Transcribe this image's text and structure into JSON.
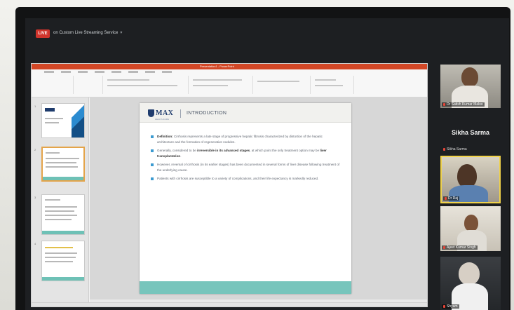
{
  "meeting": {
    "live_label": "LIVE",
    "title": "on Custom Live Streaming Service",
    "title_chevron": "▾"
  },
  "powerpoint": {
    "window_title": "Presentation1 - PowerPoint",
    "slide_numbers": [
      "1",
      "2",
      "3",
      "4"
    ],
    "slide": {
      "logo_text": "MAX",
      "logo_subtext": "HEALTHCARE",
      "title": "INTRODUCTION",
      "bullets": [
        {
          "bold": "Definition:",
          "text": " Cirrhosis represents a late stage of progressive hepatic fibrosis characterized by distortion of the hepatic architecture and the formation of regenerative nodules."
        },
        {
          "pre": "Generally, considered to be ",
          "bold": "irreversible in its advanced stages",
          "text": ", at which point the only treatment option may be ",
          "bold2": "liver transplantation",
          "post": "."
        },
        {
          "text": "However, reversal of cirrhosis (in its earlier stages) has been documented in several forms of liver disease following treatment of the underlying cause."
        },
        {
          "text": "Patients with cirrhosis are susceptible to a variety of complications, and their life expectancy is markedly reduced."
        }
      ]
    }
  },
  "participants": {
    "tiles": [
      {
        "name": "Dr Satish Kumar Maloo",
        "active": false
      },
      {
        "name": "Dr Raj",
        "active": true
      },
      {
        "name": "Ajeet Kumar Singh",
        "active": false
      },
      {
        "name": "Shyam",
        "active": false
      }
    ],
    "highlighted_name": "Sikha Sarma",
    "highlighted_subname": "Sikha Sarma"
  },
  "colors": {
    "live": "#d0342c",
    "ppt_accent": "#d24726",
    "slide_footer": "#77c5bc",
    "active_speaker": "#f0d24a",
    "brand_navy": "#1f3c6e"
  }
}
